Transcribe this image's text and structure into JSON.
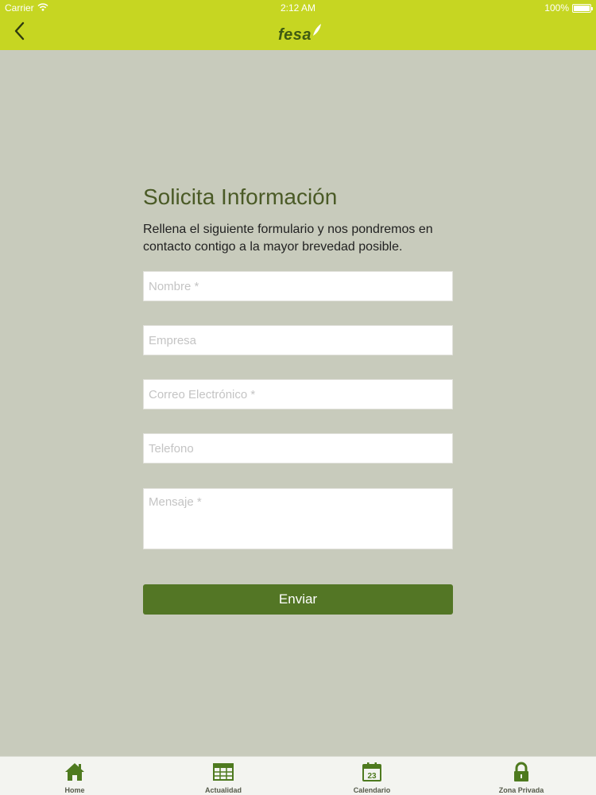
{
  "status_bar": {
    "carrier": "Carrier",
    "time": "2:12 AM",
    "battery": "100%"
  },
  "nav": {
    "logo_text": "fesa",
    "back_icon": "chevron-left-icon"
  },
  "form": {
    "title": "Solicita Información",
    "intro": "Rellena el siguiente formulario y nos pondremos en contacto contigo a la mayor brevedad posible.",
    "fields": {
      "nombre": {
        "placeholder": "Nombre *",
        "value": ""
      },
      "empresa": {
        "placeholder": "Empresa",
        "value": ""
      },
      "correo": {
        "placeholder": "Correo Electrónico *",
        "value": ""
      },
      "telefono": {
        "placeholder": "Telefono",
        "value": ""
      },
      "mensaje": {
        "placeholder": "Mensaje *",
        "value": ""
      }
    },
    "submit_label": "Enviar"
  },
  "tabs": [
    {
      "label": "Home",
      "icon": "home-icon"
    },
    {
      "label": "Actualidad",
      "icon": "news-grid-icon"
    },
    {
      "label": "Calendario",
      "icon": "calendar-icon",
      "day": "23"
    },
    {
      "label": "Zona Privada",
      "icon": "lock-icon"
    }
  ],
  "colors": {
    "brand_green": "#c6d622",
    "button_green": "#537625",
    "background": "#c8cbbc",
    "icon_green": "#4e7a1f"
  }
}
